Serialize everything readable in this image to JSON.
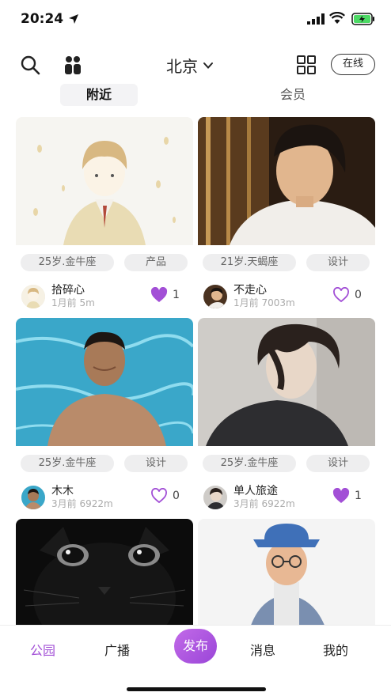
{
  "status": {
    "time": "20:24"
  },
  "header": {
    "city": "北京",
    "online_label": "在线"
  },
  "tabs": [
    {
      "label": "附近"
    },
    {
      "label": "会员"
    }
  ],
  "cards": [
    {
      "tag1": "25岁.金牛座",
      "tag2": "产品",
      "name": "拾碎心",
      "meta": "1月前 5m",
      "likes": "1",
      "liked": true
    },
    {
      "tag1": "21岁.天蝎座",
      "tag2": "设计",
      "name": "不走心",
      "meta": "1月前 7003m",
      "likes": "0",
      "liked": false
    },
    {
      "tag1": "25岁.金牛座",
      "tag2": "设计",
      "name": "木木",
      "meta": "3月前 6922m",
      "likes": "0",
      "liked": false
    },
    {
      "tag1": "25岁.金牛座",
      "tag2": "设计",
      "name": "单人旅途",
      "meta": "3月前 6922m",
      "likes": "1",
      "liked": true
    }
  ],
  "nav": {
    "park": "公园",
    "broadcast": "广播",
    "publish": "发布",
    "messages": "消息",
    "me": "我的"
  },
  "colors": {
    "accent": "#a24fd6",
    "liked_heart": "#a24fd6",
    "tag_bg": "#eeeeef"
  }
}
